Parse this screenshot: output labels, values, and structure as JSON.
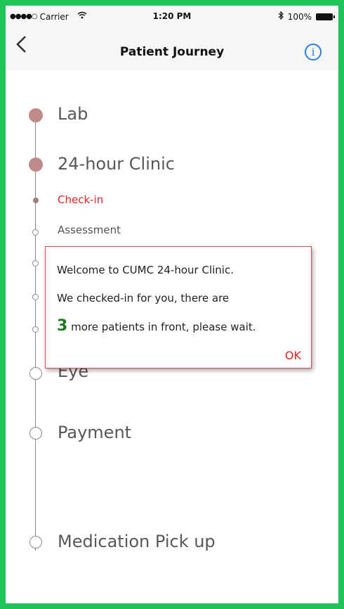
{
  "status_bar": {
    "signal": "●●●●○",
    "carrier": "Carrier",
    "time": "1:20 PM",
    "battery": "100%"
  },
  "nav": {
    "back_icon": "chevron-left-icon",
    "title": "Patient Journey",
    "info_icon": "info-icon",
    "info_glyph": "i"
  },
  "journey": {
    "steps": [
      {
        "label": "Lab",
        "state": "completed"
      },
      {
        "label": "24-hour Clinic",
        "state": "current",
        "substeps": [
          {
            "label": "Check-in",
            "state": "active"
          },
          {
            "label": "Assessment",
            "state": "pending"
          }
        ]
      },
      {
        "label": "Eye",
        "state": "pending"
      },
      {
        "label": "Payment",
        "state": "pending"
      },
      {
        "label": "Medication Pick up",
        "state": "pending"
      }
    ]
  },
  "dialog": {
    "line1": "Welcome to CUMC 24-hour Clinic.",
    "line2": "We checked-in for you, there are",
    "count": "3",
    "line3_rest": " more patients in front, please wait.",
    "ok_label": "OK"
  },
  "colors": {
    "frame_border": "#1fc35a",
    "completed_node": "#c08a88",
    "active_text": "#e02424",
    "count_text": "#1e7a1e",
    "info_accent": "#2b7de0"
  }
}
